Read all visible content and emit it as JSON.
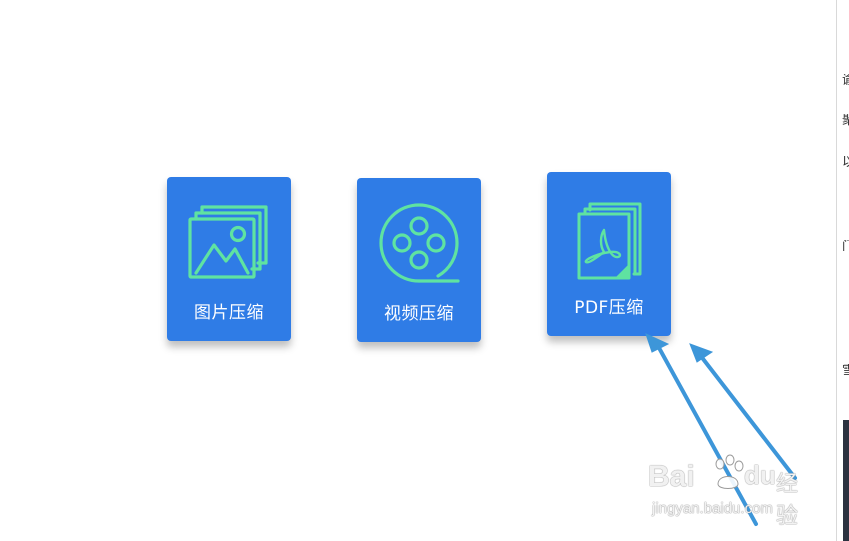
{
  "colors": {
    "card_bg": "#2f7ce6",
    "icon_stroke": "#5fe3a1",
    "arrow": "#3d96d9"
  },
  "tools": [
    {
      "label": "图片压缩",
      "icon": "image-gallery-icon"
    },
    {
      "label": "视频压缩",
      "icon": "film-reel-icon"
    },
    {
      "label": "PDF压缩",
      "icon": "pdf-document-icon"
    }
  ],
  "right_edge_glyphs": [
    "谕",
    "聚",
    "以",
    "门",
    "雪"
  ],
  "watermark": {
    "logo": "Bai",
    "logo_suffix": "du",
    "name": "经验",
    "url": "jingyan.baidu.com"
  }
}
